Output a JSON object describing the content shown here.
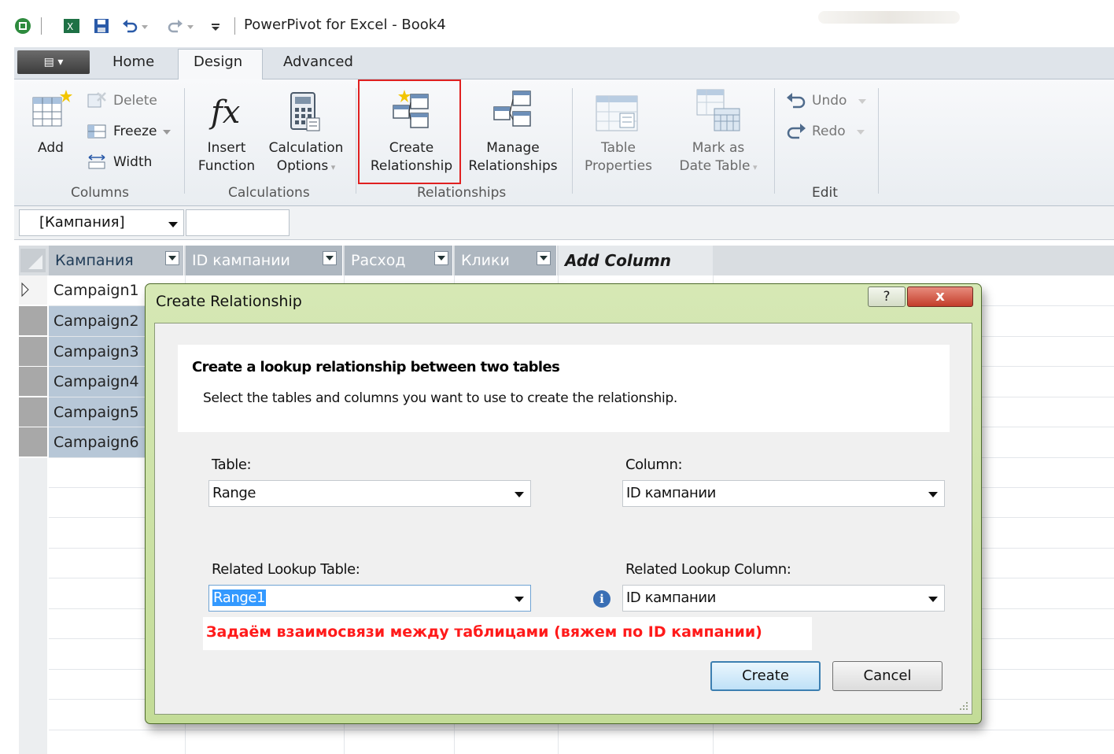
{
  "titlebar": {
    "title": "PowerPivot for Excel - Book4"
  },
  "tabs": {
    "file": "▤ ▾",
    "home": "Home",
    "design": "Design",
    "advanced": "Advanced"
  },
  "ribbon": {
    "columns": {
      "add": "Add",
      "delete": "Delete",
      "freeze": "Freeze",
      "width": "Width",
      "group": "Columns"
    },
    "calculations": {
      "insert_1": "Insert",
      "insert_2": "Function",
      "calc_1": "Calculation",
      "calc_2": "Options",
      "group": "Calculations"
    },
    "relationships": {
      "create_1": "Create",
      "create_2": "Relationship",
      "manage_1": "Manage",
      "manage_2": "Relationships",
      "group": "Relationships"
    },
    "table_props": {
      "l1": "Table",
      "l2": "Properties"
    },
    "date_table": {
      "l1": "Mark as",
      "l2": "Date Table"
    },
    "edit": {
      "undo": "Undo",
      "redo": "Redo",
      "group": "Edit"
    }
  },
  "formula_bar": {
    "name_box": "[Кампания]"
  },
  "grid": {
    "columns": [
      "Кампания",
      "ID кампании",
      "Расход",
      "Клики"
    ],
    "add_column": "Add Column",
    "rows": [
      "Campaign1",
      "Campaign2",
      "Campaign3",
      "Campaign4",
      "Campaign5",
      "Campaign6"
    ]
  },
  "dialog": {
    "title": "Create Relationship",
    "help": "?",
    "close": "x",
    "heading": "Create a lookup relationship between two tables",
    "description": "Select the tables and columns you want to use to create the relationship.",
    "table_label": "Table:",
    "table_value": "Range",
    "column_label": "Column:",
    "column_value": "ID кампании",
    "lookup_table_label": "Related Lookup Table:",
    "lookup_table_value": "Range1",
    "lookup_column_label": "Related Lookup Column:",
    "lookup_column_value": "ID кампании",
    "info": "i",
    "create_button": "Create",
    "cancel_button": "Cancel"
  },
  "annotation": "Задаём взаимосвязи между таблицами (вяжем по ID кампании)"
}
